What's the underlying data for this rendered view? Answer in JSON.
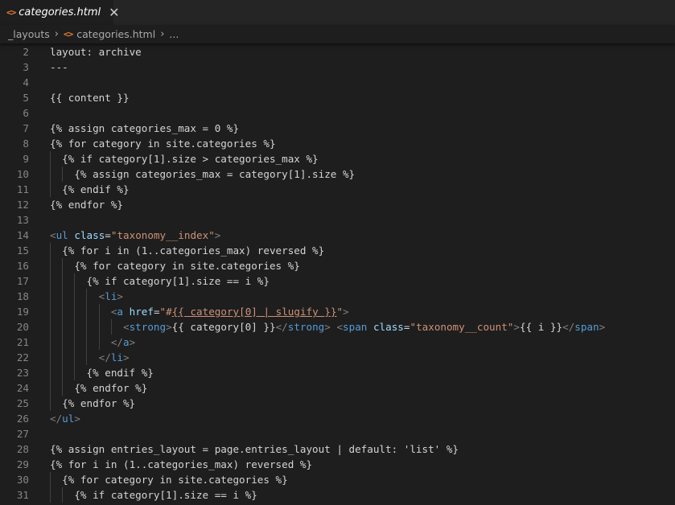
{
  "tab": {
    "label": "categories.html",
    "icon": "html-file-icon",
    "close_glyph": "✕"
  },
  "breadcrumb": {
    "folder": "_layouts",
    "file": "categories.html",
    "more": "..."
  },
  "editor": {
    "lines": [
      {
        "n": "2",
        "indent": 0,
        "tokens": [
          {
            "c": "t-text",
            "t": "layout: archive"
          }
        ]
      },
      {
        "n": "3",
        "indent": 0,
        "tokens": [
          {
            "c": "t-text",
            "t": "---"
          }
        ]
      },
      {
        "n": "4",
        "indent": 0,
        "tokens": []
      },
      {
        "n": "5",
        "indent": 0,
        "tokens": [
          {
            "c": "t-text",
            "t": "{{ content }}"
          }
        ]
      },
      {
        "n": "6",
        "indent": 0,
        "tokens": []
      },
      {
        "n": "7",
        "indent": 0,
        "tokens": [
          {
            "c": "t-text",
            "t": "{% assign categories_max = 0 %}"
          }
        ]
      },
      {
        "n": "8",
        "indent": 0,
        "tokens": [
          {
            "c": "t-text",
            "t": "{% for category in site.categories %}"
          }
        ]
      },
      {
        "n": "9",
        "indent": 1,
        "tokens": [
          {
            "c": "t-text",
            "t": "{% if category[1].size > categories_max %}"
          }
        ]
      },
      {
        "n": "10",
        "indent": 2,
        "tokens": [
          {
            "c": "t-text",
            "t": "{% assign categories_max = category[1].size %}"
          }
        ]
      },
      {
        "n": "11",
        "indent": 1,
        "tokens": [
          {
            "c": "t-text",
            "t": "{% endif %}"
          }
        ]
      },
      {
        "n": "12",
        "indent": 0,
        "tokens": [
          {
            "c": "t-text",
            "t": "{% endfor %}"
          }
        ]
      },
      {
        "n": "13",
        "indent": 0,
        "tokens": []
      },
      {
        "n": "14",
        "indent": 0,
        "tokens": [
          {
            "c": "t-punct",
            "t": "<"
          },
          {
            "c": "t-tag",
            "t": "ul"
          },
          {
            "c": "t-text",
            "t": " "
          },
          {
            "c": "t-attr",
            "t": "class"
          },
          {
            "c": "t-text",
            "t": "="
          },
          {
            "c": "t-str",
            "t": "\"taxonomy__index\""
          },
          {
            "c": "t-punct",
            "t": ">"
          }
        ]
      },
      {
        "n": "15",
        "indent": 1,
        "tokens": [
          {
            "c": "t-text",
            "t": "{% for i in (1..categories_max) reversed %}"
          }
        ]
      },
      {
        "n": "16",
        "indent": 2,
        "tokens": [
          {
            "c": "t-text",
            "t": "{% for category in site.categories %}"
          }
        ]
      },
      {
        "n": "17",
        "indent": 3,
        "tokens": [
          {
            "c": "t-text",
            "t": "{% if category[1].size == i %}"
          }
        ]
      },
      {
        "n": "18",
        "indent": 4,
        "tokens": [
          {
            "c": "t-punct",
            "t": "<"
          },
          {
            "c": "t-tag",
            "t": "li"
          },
          {
            "c": "t-punct",
            "t": ">"
          }
        ]
      },
      {
        "n": "19",
        "indent": 5,
        "tokens": [
          {
            "c": "t-punct",
            "t": "<"
          },
          {
            "c": "t-tag",
            "t": "a"
          },
          {
            "c": "t-text",
            "t": " "
          },
          {
            "c": "t-attr",
            "t": "href"
          },
          {
            "c": "t-text",
            "t": "="
          },
          {
            "c": "t-str",
            "t": "\"#"
          },
          {
            "c": "t-link",
            "t": "{{ category[0] | slugify }}"
          },
          {
            "c": "t-str",
            "t": "\""
          },
          {
            "c": "t-punct",
            "t": ">"
          }
        ]
      },
      {
        "n": "20",
        "indent": 6,
        "tokens": [
          {
            "c": "t-punct",
            "t": "<"
          },
          {
            "c": "t-tag",
            "t": "strong"
          },
          {
            "c": "t-punct",
            "t": ">"
          },
          {
            "c": "t-text",
            "t": "{{ category[0] }}"
          },
          {
            "c": "t-punct",
            "t": "</"
          },
          {
            "c": "t-tag",
            "t": "strong"
          },
          {
            "c": "t-punct",
            "t": ">"
          },
          {
            "c": "t-text",
            "t": " "
          },
          {
            "c": "t-punct",
            "t": "<"
          },
          {
            "c": "t-tag",
            "t": "span"
          },
          {
            "c": "t-text",
            "t": " "
          },
          {
            "c": "t-attr",
            "t": "class"
          },
          {
            "c": "t-text",
            "t": "="
          },
          {
            "c": "t-str",
            "t": "\"taxonomy__count\""
          },
          {
            "c": "t-punct",
            "t": ">"
          },
          {
            "c": "t-text",
            "t": "{{ i }}"
          },
          {
            "c": "t-punct",
            "t": "</"
          },
          {
            "c": "t-tag",
            "t": "span"
          },
          {
            "c": "t-punct",
            "t": ">"
          }
        ]
      },
      {
        "n": "21",
        "indent": 5,
        "tokens": [
          {
            "c": "t-punct",
            "t": "</"
          },
          {
            "c": "t-tag",
            "t": "a"
          },
          {
            "c": "t-punct",
            "t": ">"
          }
        ]
      },
      {
        "n": "22",
        "indent": 4,
        "tokens": [
          {
            "c": "t-punct",
            "t": "</"
          },
          {
            "c": "t-tag",
            "t": "li"
          },
          {
            "c": "t-punct",
            "t": ">"
          }
        ]
      },
      {
        "n": "23",
        "indent": 3,
        "tokens": [
          {
            "c": "t-text",
            "t": "{% endif %}"
          }
        ]
      },
      {
        "n": "24",
        "indent": 2,
        "tokens": [
          {
            "c": "t-text",
            "t": "{% endfor %}"
          }
        ]
      },
      {
        "n": "25",
        "indent": 1,
        "tokens": [
          {
            "c": "t-text",
            "t": "{% endfor %}"
          }
        ]
      },
      {
        "n": "26",
        "indent": 0,
        "tokens": [
          {
            "c": "t-punct",
            "t": "</"
          },
          {
            "c": "t-tag",
            "t": "ul"
          },
          {
            "c": "t-punct",
            "t": ">"
          }
        ]
      },
      {
        "n": "27",
        "indent": 0,
        "tokens": []
      },
      {
        "n": "28",
        "indent": 0,
        "tokens": [
          {
            "c": "t-text",
            "t": "{% assign entries_layout = page.entries_layout | default: 'list' %}"
          }
        ]
      },
      {
        "n": "29",
        "indent": 0,
        "tokens": [
          {
            "c": "t-text",
            "t": "{% for i in (1..categories_max) reversed %}"
          }
        ]
      },
      {
        "n": "30",
        "indent": 1,
        "tokens": [
          {
            "c": "t-text",
            "t": "{% for category in site.categories %}"
          }
        ]
      },
      {
        "n": "31",
        "indent": 2,
        "tokens": [
          {
            "c": "t-text",
            "t": "{% if category[1].size == i %}"
          }
        ]
      }
    ]
  }
}
